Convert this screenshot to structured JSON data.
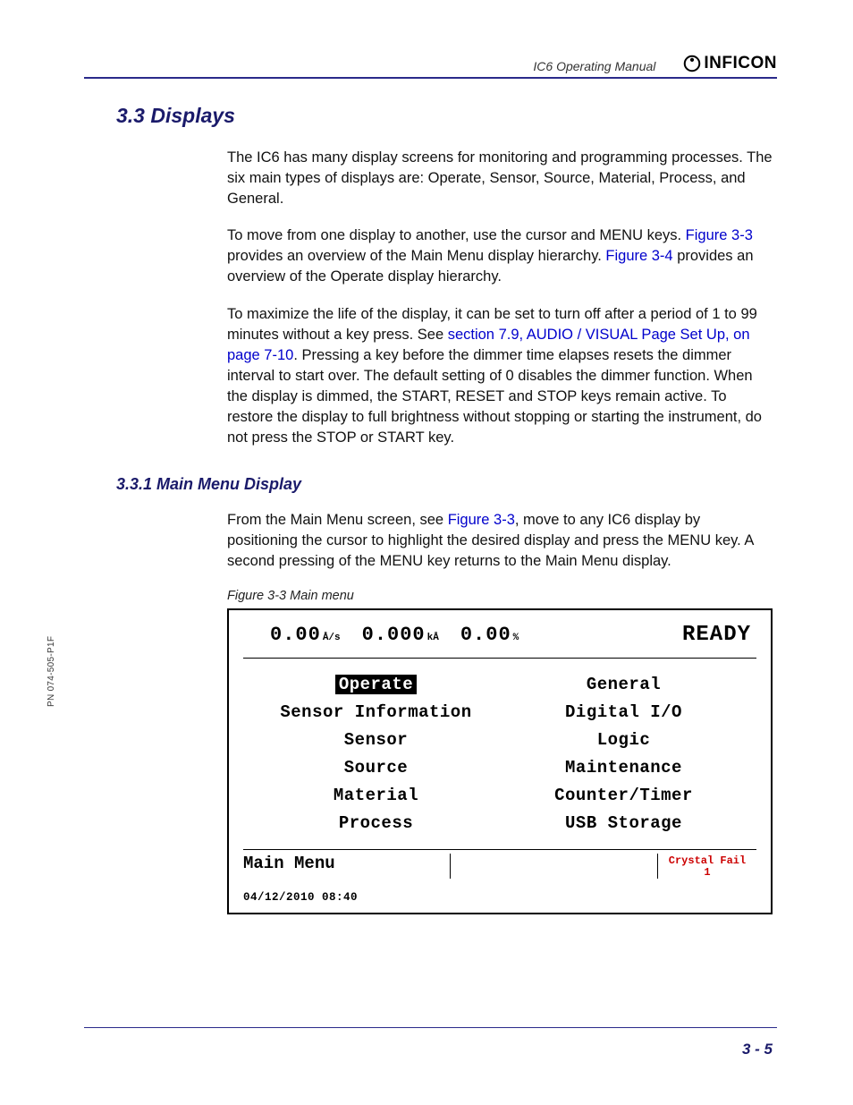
{
  "header": {
    "doc_title": "IC6 Operating Manual",
    "brand": "INFICON"
  },
  "side_pn": "PN 074-505-P1F",
  "section": {
    "num_title": "3.3  Displays",
    "p1": "The IC6 has many display screens for monitoring and programming processes. The six main types of displays are: Operate, Sensor, Source, Material, Process, and General.",
    "p2a": "To move from one display to another, use the cursor and MENU keys. ",
    "p2_link1": "Figure 3-3",
    "p2b": " provides an overview of the Main Menu display hierarchy. ",
    "p2_link2": "Figure 3-4",
    "p2c": " provides an overview of the Operate display hierarchy.",
    "p3a": "To maximize the life of the display, it can be set to turn off after a period of 1 to 99 minutes without a key press. See ",
    "p3_link": "section 7.9, AUDIO / VISUAL Page Set Up, on page 7-10",
    "p3b": ". Pressing a key before the dimmer time elapses resets the dimmer interval to start over. The default setting of 0 disables the dimmer function. When the display is dimmed, the START, RESET and STOP keys remain active. To restore the display to full brightness without stopping or starting the instrument, do not press the STOP or START key."
  },
  "subsection": {
    "num_title": "3.3.1  Main Menu Display",
    "p1a": "From the Main Menu screen, see ",
    "p1_link": "Figure 3-3",
    "p1b": ", move to any IC6 display by positioning the cursor to highlight the desired display and press the MENU key. A second pressing of the MENU key returns to the Main Menu display."
  },
  "figure": {
    "caption": "Figure 3-3   Main menu",
    "readouts": [
      {
        "value": "0.00",
        "unit": "Å/s"
      },
      {
        "value": "0.000",
        "unit": "kÅ"
      },
      {
        "value": "0.00",
        "unit": "%"
      }
    ],
    "ready": "READY",
    "left_col": [
      "Operate",
      "Sensor Information",
      "Sensor",
      "Source",
      "Material",
      "Process"
    ],
    "right_col": [
      "General",
      "Digital I/O",
      "Logic",
      "Maintenance",
      "Counter/Timer",
      "USB Storage"
    ],
    "status_label": "Main Menu",
    "alarm": "Crystal Fail",
    "alarm_sub": "1",
    "datetime": "04/12/2010  08:40"
  },
  "page_number": "3 - 5"
}
